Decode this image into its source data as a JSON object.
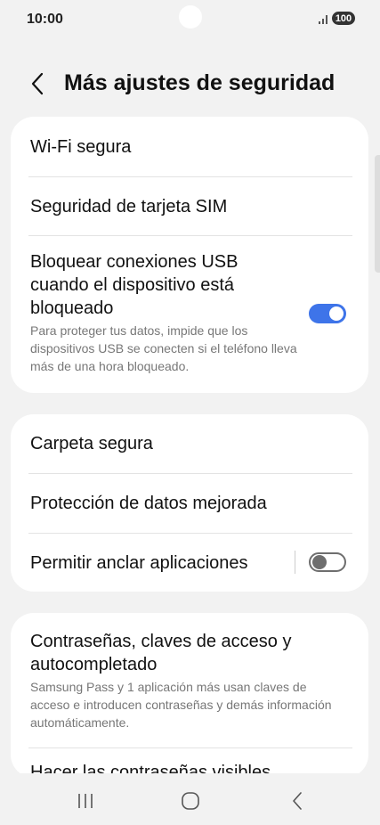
{
  "status_bar": {
    "time": "10:00",
    "battery_level": "100",
    "signal_icon": "signal-bars-icon"
  },
  "header": {
    "back_icon": "chevron-left-icon",
    "title": "Más ajustes de seguridad"
  },
  "group1": {
    "wifi_segura": "Wi-Fi segura",
    "sim_security": "Seguridad de tarjeta SIM",
    "usb_block_title": "Bloquear conexiones USB cuando el dispositivo está bloqueado",
    "usb_block_desc": "Para proteger tus datos, impide que los dispositivos USB se conecten si el teléfono lleva más de una hora bloqueado.",
    "usb_block_enabled": true
  },
  "group2": {
    "secure_folder": "Carpeta segura",
    "data_protection": "Protección de datos mejorada",
    "pin_apps": "Permitir anclar aplicaciones",
    "pin_apps_enabled": false
  },
  "group3": {
    "passwords_title": "Contraseñas, claves de acceso y autocompletado",
    "passwords_desc": "Samsung Pass y 1 aplicación más usan claves de acceso e introducen contraseñas y demás información automáticamente.",
    "visible_passwords": "Hacer las contraseñas visibles"
  },
  "nav": {
    "recents_icon": "recents-icon",
    "home_icon": "home-icon",
    "back_icon": "back-icon"
  },
  "colors": {
    "accent": "#3e74e9",
    "background": "#f2f2f2",
    "card": "#ffffff"
  }
}
